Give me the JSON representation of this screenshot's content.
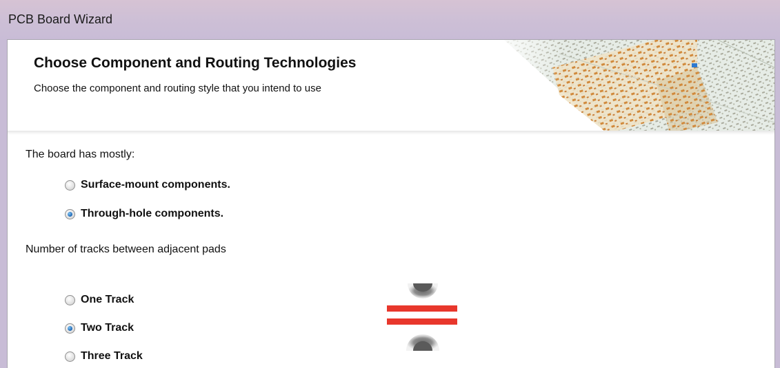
{
  "window": {
    "title": "PCB Board Wizard"
  },
  "header": {
    "title": "Choose Component and Routing Technologies",
    "subtitle": "Choose the component and routing style that you intend to use"
  },
  "component_group": {
    "label": "The board has mostly:",
    "options": [
      {
        "label": "Surface-mount components.",
        "checked": false
      },
      {
        "label": "Through-hole components.",
        "checked": true
      }
    ]
  },
  "tracks_group": {
    "label": "Number of tracks between adjacent pads",
    "options": [
      {
        "label": "One Track",
        "checked": false
      },
      {
        "label": "Two Track",
        "checked": true
      },
      {
        "label": "Three Track",
        "checked": false
      }
    ]
  },
  "colors": {
    "track_red": "#e8372c",
    "radio_selected": "#1d66b4"
  }
}
